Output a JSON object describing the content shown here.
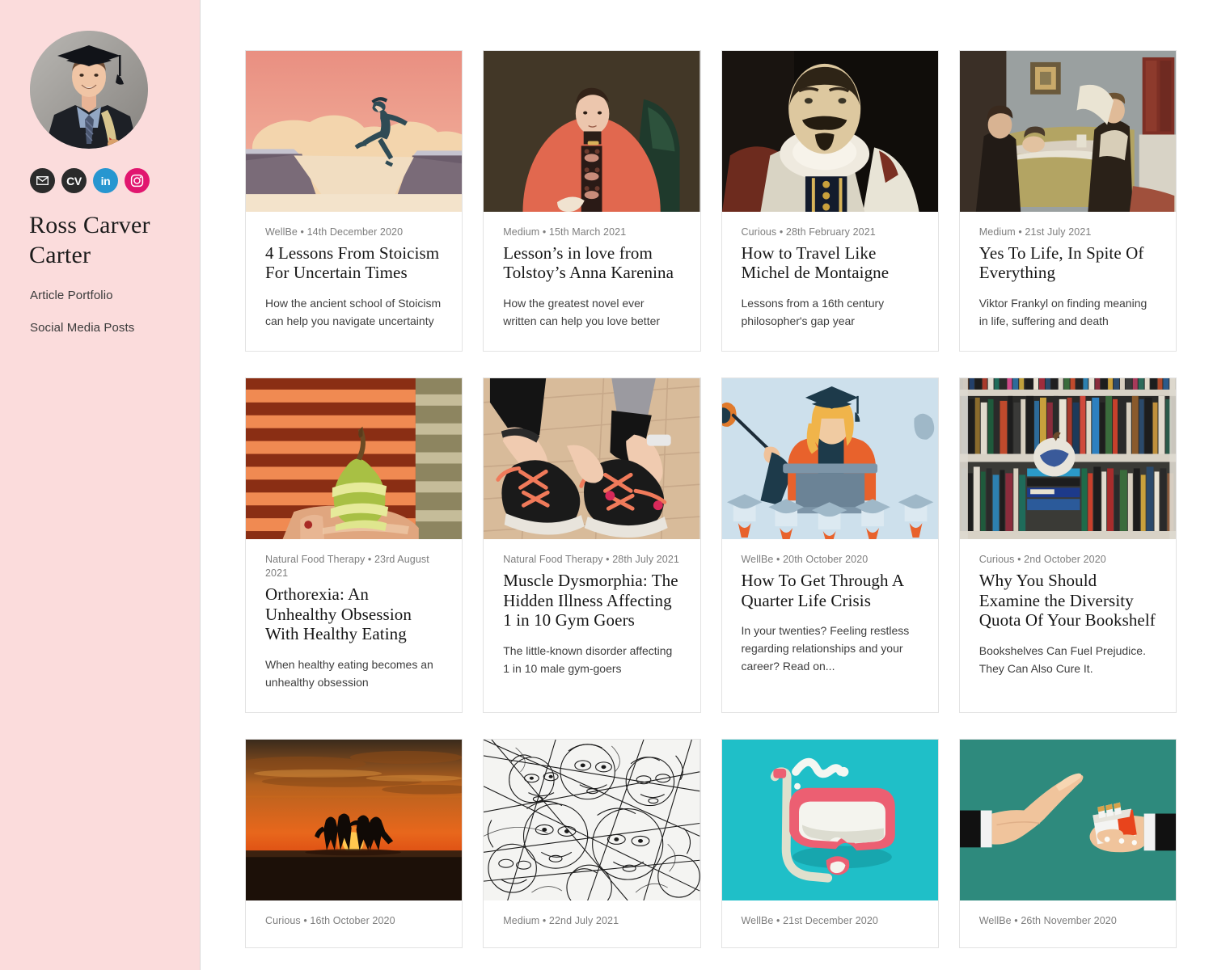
{
  "sidebar": {
    "avatar_alt": "graduation-photo",
    "name": "Ross Carver Carter",
    "social": [
      {
        "id": "email",
        "label": "✉",
        "name": "email-icon",
        "color": "#2b2b2b"
      },
      {
        "id": "cv",
        "label": "CV",
        "name": "cv-icon",
        "color": "#2b2b2b"
      },
      {
        "id": "linkedin",
        "label": "in",
        "name": "linkedin-icon",
        "color": "#2796d0"
      },
      {
        "id": "instagram",
        "label": "",
        "name": "instagram-icon",
        "color": "#e1166f"
      }
    ],
    "nav": [
      {
        "label": "Article Portfolio"
      },
      {
        "label": "Social Media Posts"
      }
    ],
    "background_color": "#fbdcdc"
  },
  "cards": [
    {
      "thumb": "cliff-jump-illustration",
      "publication": "WellBe",
      "date": "14th December 2020",
      "meta": "WellBe • 14th December 2020",
      "title": "4 Lessons From Stoicism For Uncertain Times",
      "description": "How the ancient school of Stoicism can help you navigate uncertainty"
    },
    {
      "thumb": "victorian-woman-portrait",
      "publication": "Medium",
      "date": "15th March 2021",
      "meta": "Medium • 15th March 2021",
      "title": "Lesson’s in love from Tolstoy’s Anna Karenina",
      "description": "How the greatest novel ever written can help you love better"
    },
    {
      "thumb": "montaigne-portrait",
      "publication": "Curious",
      "date": "28th February 2021",
      "meta": "Curious • 28th February 2021",
      "title": "How to Travel Like Michel de Montaigne",
      "description": "Lessons from a 16th century philosopher's gap year"
    },
    {
      "thumb": "science-of-charity-painting",
      "publication": "Medium",
      "date": "21st July 2021",
      "meta": "Medium • 21st July 2021",
      "title": "Yes To Life, In Spite Of Everything",
      "description": "Viktor Frankyl on finding meaning in life, suffering and death"
    },
    {
      "thumb": "pear-in-hand-photo",
      "publication": "Natural Food Therapy",
      "date": "23rd August 2021",
      "meta": "Natural Food Therapy • 23rd August 2021",
      "title": "Orthorexia: An Unhealthy Obsession With Healthy Eating",
      "description": "When healthy eating becomes an unhealthy obsession"
    },
    {
      "thumb": "tying-trainers-photo",
      "publication": "Natural Food Therapy",
      "date": "28th July 2021",
      "meta": "Natural Food Therapy • 28th July 2021",
      "title": "Muscle Dysmorphia: The Hidden Illness Affecting 1 in 10 Gym Goers",
      "description": "The little-known disorder affecting 1 in 10 male gym-goers"
    },
    {
      "thumb": "graduation-lecture-illustration",
      "publication": "WellBe",
      "date": "20th October 2020",
      "meta": "WellBe • 20th October 2020",
      "title": "How To Get Through A Quarter Life Crisis",
      "description": "In your twenties? Feeling restless regarding relationships and your career? Read on..."
    },
    {
      "thumb": "bookshelf-photo",
      "publication": "Curious",
      "date": "2nd October 2020",
      "meta": "Curious • 2nd October 2020",
      "title": "Why You Should Examine the Diversity Quota Of Your Bookshelf",
      "description": "Bookshelves Can Fuel Prejudice. They Can Also Cure It."
    },
    {
      "thumb": "beach-sunset-photo",
      "publication": "Curious",
      "date": "16th October 2020",
      "meta": "Curious • 16th October 2020",
      "title": "",
      "description": ""
    },
    {
      "thumb": "abstract-faces-drawing",
      "publication": "Medium",
      "date": "22nd July 2021",
      "meta": "Medium • 22nd July 2021",
      "title": "",
      "description": ""
    },
    {
      "thumb": "snorkel-mask-illustration",
      "publication": "WellBe",
      "date": "21st December 2020",
      "meta": "WellBe • 21st December 2020",
      "title": "",
      "description": ""
    },
    {
      "thumb": "refusing-cigarettes-illustration",
      "publication": "WellBe",
      "date": "26th November 2020",
      "meta": "WellBe • 26th November 2020",
      "title": "",
      "description": ""
    }
  ]
}
